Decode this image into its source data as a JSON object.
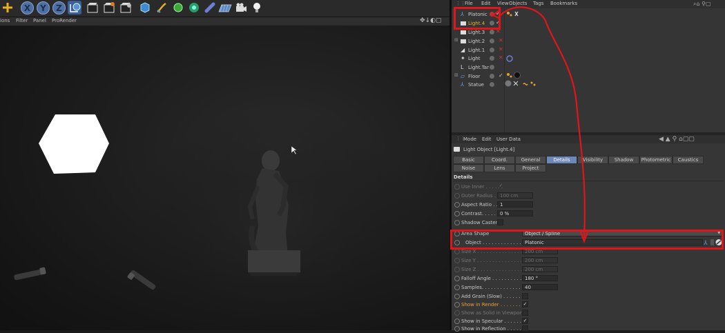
{
  "viewport_menu": [
    "ions",
    "Filter",
    "Panel",
    "ProRender"
  ],
  "toolbar_axes": [
    "X",
    "Y",
    "Z"
  ],
  "object_manager": {
    "menu": [
      "File",
      "Edit",
      "View",
      "Objects",
      "Tags",
      "Bookmarks"
    ],
    "objects": [
      {
        "name": "Platonic",
        "highlight": false
      },
      {
        "name": "Light.4",
        "highlight": true
      },
      {
        "name": "Light.3",
        "highlight": false
      },
      {
        "name": "Light.2",
        "highlight": false
      },
      {
        "name": "Light.1",
        "highlight": false
      },
      {
        "name": "Light",
        "highlight": false
      },
      {
        "name": "Light.Tar",
        "highlight": false
      },
      {
        "name": "Floor",
        "highlight": false
      },
      {
        "name": "Statue",
        "highlight": false
      }
    ]
  },
  "attribute_manager": {
    "menu": [
      "Mode",
      "Edit",
      "User Data"
    ],
    "object_title": "Light Object [Light.4]",
    "tabs_row1": [
      "Basic",
      "Coord.",
      "General",
      "Details",
      "Visibility",
      "Shadow",
      "Photometric",
      "Caustics"
    ],
    "tabs_row2": [
      "Noise",
      "Lens",
      "Project"
    ],
    "active_tab": "Details",
    "section_title": "Details",
    "params": [
      {
        "label": "Use Inner . . . . . .",
        "type": "check",
        "value": "✓",
        "dim": true
      },
      {
        "label": "Outer Radius . .",
        "type": "field",
        "value": "100 cm",
        "dim": true
      },
      {
        "label": "Aspect Ratio . .",
        "type": "field",
        "value": "1",
        "dim": false
      },
      {
        "label": "Contrast. . . . . .",
        "type": "field",
        "value": "0 %",
        "dim": false
      },
      {
        "label": "Shadow Caster",
        "type": "check",
        "value": "",
        "dim": false
      },
      {
        "label": "Area Shape",
        "type": "dropdown",
        "value": "Object / Spline",
        "dim": false
      },
      {
        "label": "Object . . . . . . . . . . . . . . .",
        "type": "link",
        "value": "Platonic",
        "dim": false
      },
      {
        "label": "Size X . . . . . . . . . . . . . . .",
        "type": "field",
        "value": "200 cm",
        "dim": true
      },
      {
        "label": "Size Y . . . . . . . . . . . . . . .",
        "type": "field",
        "value": "200 cm",
        "dim": true
      },
      {
        "label": "Size Z . . . . . . . . . . . . . . .",
        "type": "field",
        "value": "200 cm",
        "dim": true
      },
      {
        "label": "Falloff Angle . . . . . . . . . . .",
        "type": "field",
        "value": "180 °",
        "dim": false
      },
      {
        "label": "Samples. . . . . . . . . . . . . . .",
        "type": "field",
        "value": "40",
        "dim": false
      },
      {
        "label": "Add Grain (Slow) . . . . . . . .",
        "type": "check",
        "value": "",
        "dim": false
      },
      {
        "label": "Show in Render . . . . . . . . .",
        "type": "check",
        "value": "✓",
        "dim": false,
        "orange": true
      },
      {
        "label": "Show as Solid in Viewport",
        "type": "check",
        "value": "",
        "dim": true
      },
      {
        "label": "Show in Specular . . . . . . . .",
        "type": "check",
        "value": "✓",
        "dim": false
      },
      {
        "label": "Show in Reflection . . . . . . .",
        "type": "check",
        "value": "",
        "dim": false
      }
    ]
  }
}
